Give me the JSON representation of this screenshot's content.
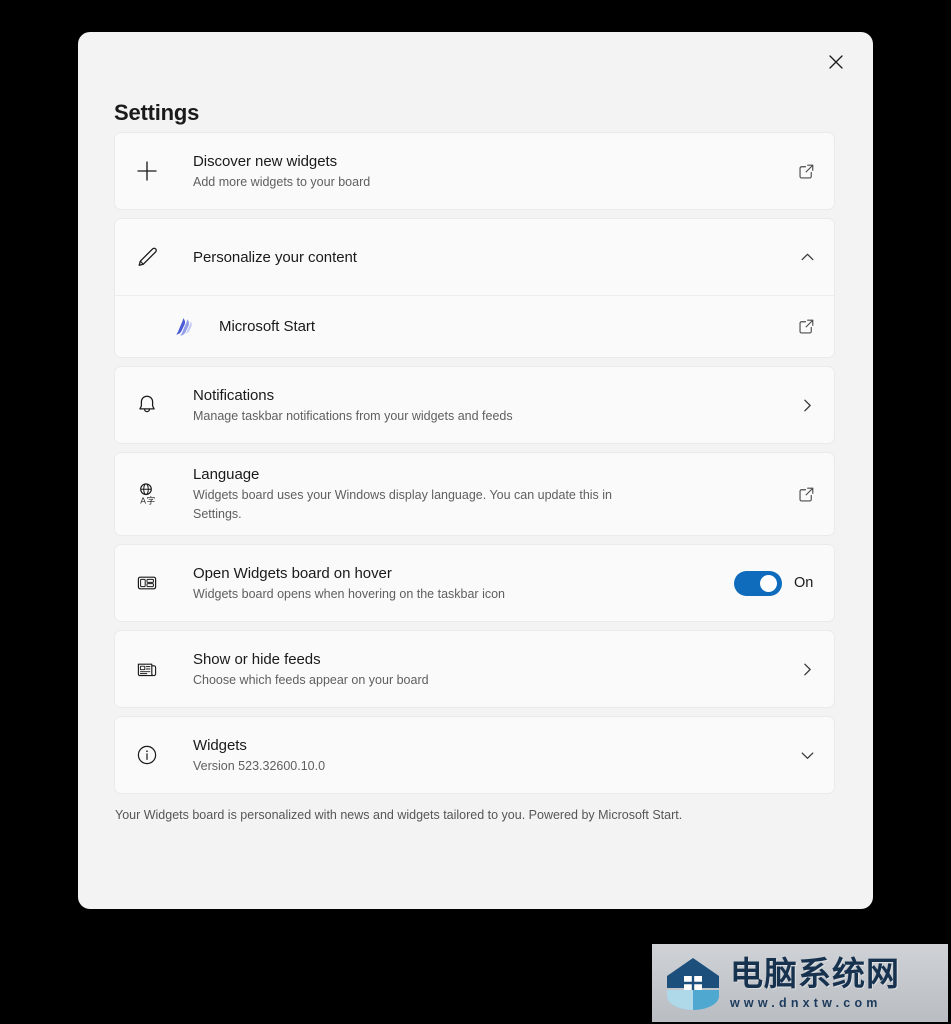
{
  "dialog": {
    "title": "Settings",
    "close_icon": "close-icon"
  },
  "settings": {
    "groups": [
      {
        "rows": [
          {
            "icon": "plus-icon",
            "title": "Discover new widgets",
            "subtitle": "Add more widgets to your board",
            "action_icon": "external-link-icon"
          }
        ]
      },
      {
        "rows": [
          {
            "icon": "pencil-icon",
            "title": "Personalize your content",
            "subtitle": "",
            "action_icon": "chevron-up-icon"
          },
          {
            "icon": "microsoft-start-icon",
            "title": "Microsoft Start",
            "subtitle": "",
            "action_icon": "external-link-icon"
          }
        ]
      },
      {
        "rows": [
          {
            "icon": "bell-icon",
            "title": "Notifications",
            "subtitle": "Manage taskbar notifications from your widgets and feeds",
            "action_icon": "chevron-right-icon"
          }
        ]
      },
      {
        "rows": [
          {
            "icon": "language-globe-icon",
            "title": "Language",
            "subtitle": "Widgets board uses your Windows display language. You can update this in Settings.",
            "action_icon": "external-link-icon"
          }
        ]
      },
      {
        "rows": [
          {
            "icon": "board-layout-icon",
            "title": "Open Widgets board on hover",
            "subtitle": "Widgets board opens when hovering on the taskbar icon",
            "action_icon": "toggle",
            "toggle_state": "On"
          }
        ]
      },
      {
        "rows": [
          {
            "icon": "feed-icon",
            "title": "Show or hide feeds",
            "subtitle": "Choose which feeds appear on your board",
            "action_icon": "chevron-right-icon"
          }
        ]
      },
      {
        "rows": [
          {
            "icon": "info-circle-icon",
            "title": "Widgets",
            "subtitle": "Version 523.32600.10.0",
            "action_icon": "chevron-down-icon"
          }
        ]
      }
    ],
    "footer_note": "Your Widgets board is personalized with news and widgets tailored to you. Powered by Microsoft Start."
  },
  "colors": {
    "accent": "#0F6CBD",
    "dialog_bg": "#F3F3F3",
    "card_bg": "#FAFAFA",
    "page_bg": "#000000"
  },
  "watermark": {
    "title": "电脑系统网",
    "url": "www.dnxtw.com"
  }
}
